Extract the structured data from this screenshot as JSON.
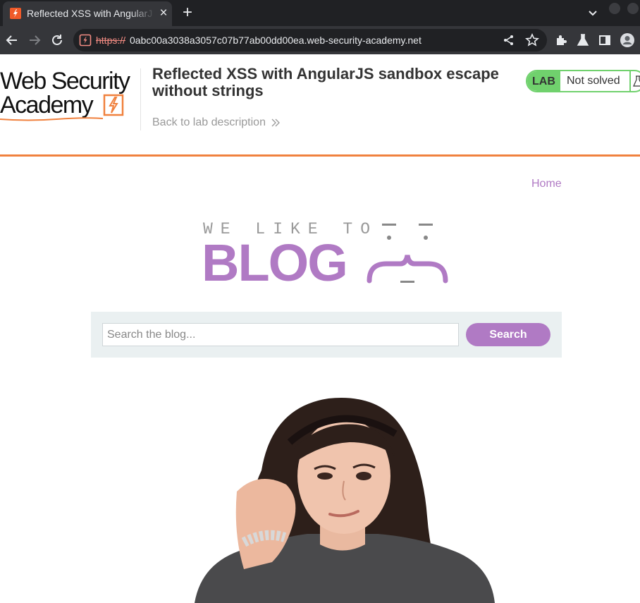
{
  "browser": {
    "tab": {
      "title": "Reflected XSS with AngularJS sandbox escape without strings"
    },
    "url": {
      "scheme": "https://",
      "host": "0abc00a3038a3057c07b77ab00dd00ea.web-security-academy.net"
    },
    "icons": [
      "back-arrow-icon",
      "forward-arrow-icon",
      "reload-icon",
      "share-icon",
      "star-icon",
      "extensions-icon",
      "labs-flask-icon",
      "sidepanel-icon",
      "profile-icon"
    ]
  },
  "lab_header": {
    "logo": {
      "line1": "Web Security",
      "line2": "Academy"
    },
    "title": "Reflected XSS with AngularJS sandbox escape without strings",
    "back_link": "Back to lab description",
    "badge": {
      "label": "LAB",
      "status": "Not solved"
    },
    "colors": {
      "accent": "#f0813e",
      "solved_green": "#70d16d"
    }
  },
  "blog": {
    "nav": {
      "home": "Home"
    },
    "logo": {
      "tagline": "WE LIKE TO",
      "word": "BLOG"
    },
    "search": {
      "placeholder": "Search the blog...",
      "value": "",
      "button": "Search"
    },
    "colors": {
      "brand": "#b07ac4",
      "search_bg": "#eaf0f1"
    }
  }
}
